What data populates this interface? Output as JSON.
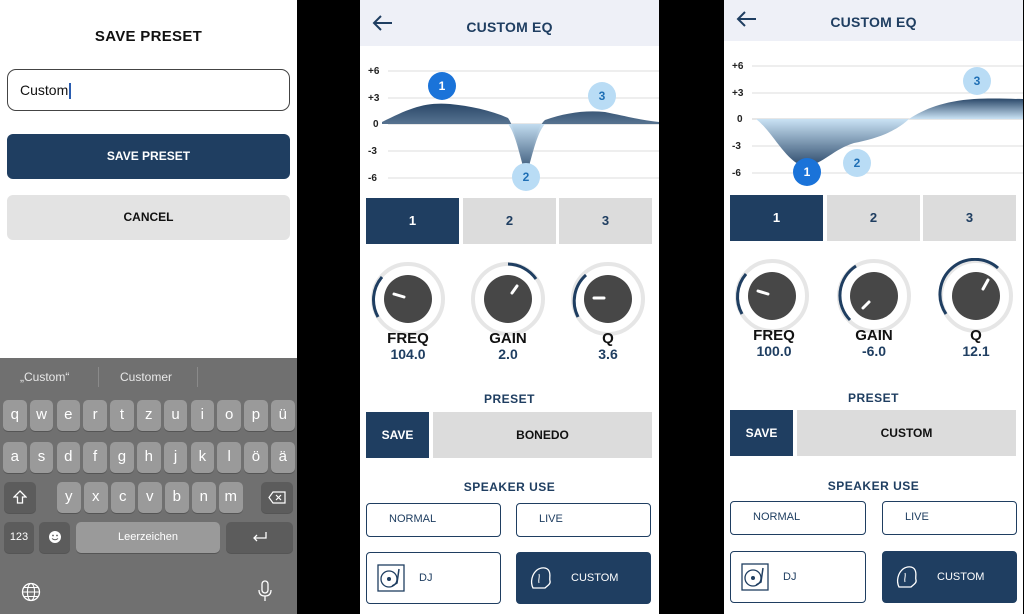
{
  "panel1": {
    "title": "SAVE PRESET",
    "input_value": "Custom",
    "save_label": "SAVE PRESET",
    "cancel_label": "CANCEL",
    "keyboard": {
      "suggestions": [
        "„Custom“",
        "Customer"
      ],
      "row1": [
        "q",
        "w",
        "e",
        "r",
        "t",
        "z",
        "u",
        "i",
        "o",
        "p",
        "ü"
      ],
      "row2": [
        "a",
        "s",
        "d",
        "f",
        "g",
        "h",
        "j",
        "k",
        "l",
        "ö",
        "ä"
      ],
      "row3": [
        "y",
        "x",
        "c",
        "v",
        "b",
        "n",
        "m"
      ],
      "numbers_label": "123",
      "space_label": "Leerzeichen"
    }
  },
  "eq_left": {
    "title": "CUSTOM EQ",
    "y_labels": [
      "+6",
      "+3",
      "0",
      "-3",
      "-6"
    ],
    "band_tabs": [
      "1",
      "2",
      "3"
    ],
    "active_band": "1",
    "points": [
      {
        "label": "1",
        "active": true
      },
      {
        "label": "2",
        "active": false
      },
      {
        "label": "3",
        "active": false
      }
    ],
    "freq_label": "FREQ",
    "freq_value": "104.0",
    "gain_label": "GAIN",
    "gain_value": "2.0",
    "q_label": "Q",
    "q_value": "3.6",
    "preset_heading": "PRESET",
    "save_label": "SAVE",
    "preset_name": "BONEDO",
    "speaker_heading": "SPEAKER USE",
    "normal_label": "NORMAL",
    "live_label": "LIVE",
    "dj_label": "DJ",
    "custom_label": "CUSTOM",
    "selected_use": "CUSTOM"
  },
  "eq_right": {
    "title": "CUSTOM EQ",
    "y_labels": [
      "+6",
      "+3",
      "0",
      "-3",
      "-6"
    ],
    "band_tabs": [
      "1",
      "2",
      "3"
    ],
    "active_band": "1",
    "points": [
      {
        "label": "1",
        "active": true
      },
      {
        "label": "2",
        "active": false
      },
      {
        "label": "3",
        "active": false
      }
    ],
    "freq_label": "FREQ",
    "freq_value": "100.0",
    "gain_label": "GAIN",
    "gain_value": "-6.0",
    "q_label": "Q",
    "q_value": "12.1",
    "preset_heading": "PRESET",
    "save_label": "SAVE",
    "preset_name": "CUSTOM",
    "speaker_heading": "SPEAKER USE",
    "normal_label": "NORMAL",
    "live_label": "LIVE",
    "dj_label": "DJ",
    "custom_label": "CUSTOM",
    "selected_use": "CUSTOM"
  },
  "colors": {
    "navy": "#1f3e61",
    "point_active": "#1a73d9",
    "point_inactive": "#b9dcf5",
    "keyboard_bg": "#707070"
  },
  "icons": {
    "back": "arrow-left-icon",
    "dj": "turntable-icon",
    "custom": "silhouette-icon",
    "globe": "globe-icon",
    "mic": "microphone-icon",
    "shift": "shift-icon",
    "delete": "backspace-icon",
    "emoji": "emoji-icon",
    "return": "return-icon"
  }
}
